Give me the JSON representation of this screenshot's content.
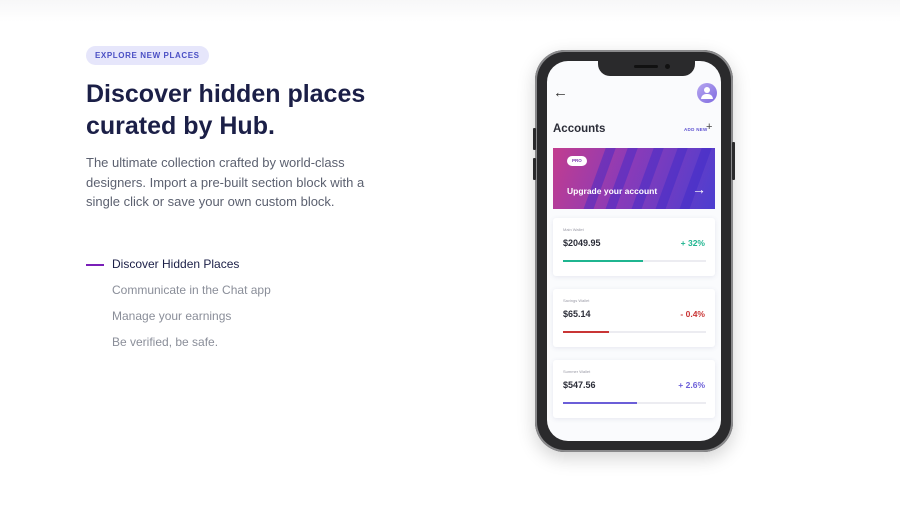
{
  "hero": {
    "badge": "EXPLORE NEW PLACES",
    "headline": "Discover hidden places curated by Hub.",
    "lead": "The ultimate collection crafted by world-class designers. Import a pre-built section block with a single click or save your own custom block."
  },
  "features": [
    {
      "label": "Discover Hidden Places",
      "active": true
    },
    {
      "label": "Communicate in the Chat app",
      "active": false
    },
    {
      "label": "Manage your earnings",
      "active": false
    },
    {
      "label": "Be verified, be safe.",
      "active": false
    }
  ],
  "phone_app": {
    "back_icon": "arrow-left-icon",
    "avatar_icon": "user-avatar-icon",
    "title": "Accounts",
    "add_new": "ADD NEW",
    "add_icon": "plus-icon",
    "promo": {
      "badge": "PRO",
      "label": "Upgrade your account",
      "arrow_icon": "arrow-right-icon"
    },
    "wallets": [
      {
        "name": "Main Wallet",
        "amount": "$2049.95",
        "change": "+ 32%",
        "progress": 0.56,
        "color": "#1fb590"
      },
      {
        "name": "Savings Wallet",
        "amount": "$65.14",
        "change": "- 0.4%",
        "progress": 0.32,
        "color": "#c93535"
      },
      {
        "name": "Summer Wallet",
        "amount": "$547.56",
        "change": "+ 2.6%",
        "progress": 0.52,
        "color": "#6b5ed8"
      }
    ]
  },
  "colors": {
    "accent": "#7a1fb8",
    "heading": "#1b1f47",
    "badge_bg": "#e6e6fb",
    "badge_text": "#4a4fc4"
  }
}
